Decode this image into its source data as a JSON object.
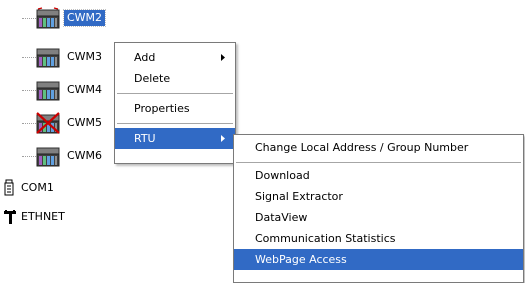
{
  "tree": {
    "rtus": [
      {
        "label": "CWM2",
        "selected": true,
        "disabled": false
      },
      {
        "label": "CWM3",
        "selected": false,
        "disabled": false
      },
      {
        "label": "CWM4",
        "selected": false,
        "disabled": false
      },
      {
        "label": "CWM5",
        "selected": false,
        "disabled": true
      },
      {
        "label": "CWM6",
        "selected": false,
        "disabled": false
      }
    ],
    "com1": "COM1",
    "ethnet": "ETHNET"
  },
  "context_menu": {
    "add": "Add",
    "delete": "Delete",
    "properties": "Properties",
    "rtu": "RTU"
  },
  "rtu_submenu": {
    "change_address": "Change Local Address / Group Number",
    "download": "Download",
    "signal_extractor": "Signal Extractor",
    "dataview": "DataView",
    "comm_stats": "Communication Statistics",
    "webpage_access": "WebPage Access"
  },
  "colors": {
    "selection": "#316ac5",
    "disabled_mark": "#cc0000"
  }
}
